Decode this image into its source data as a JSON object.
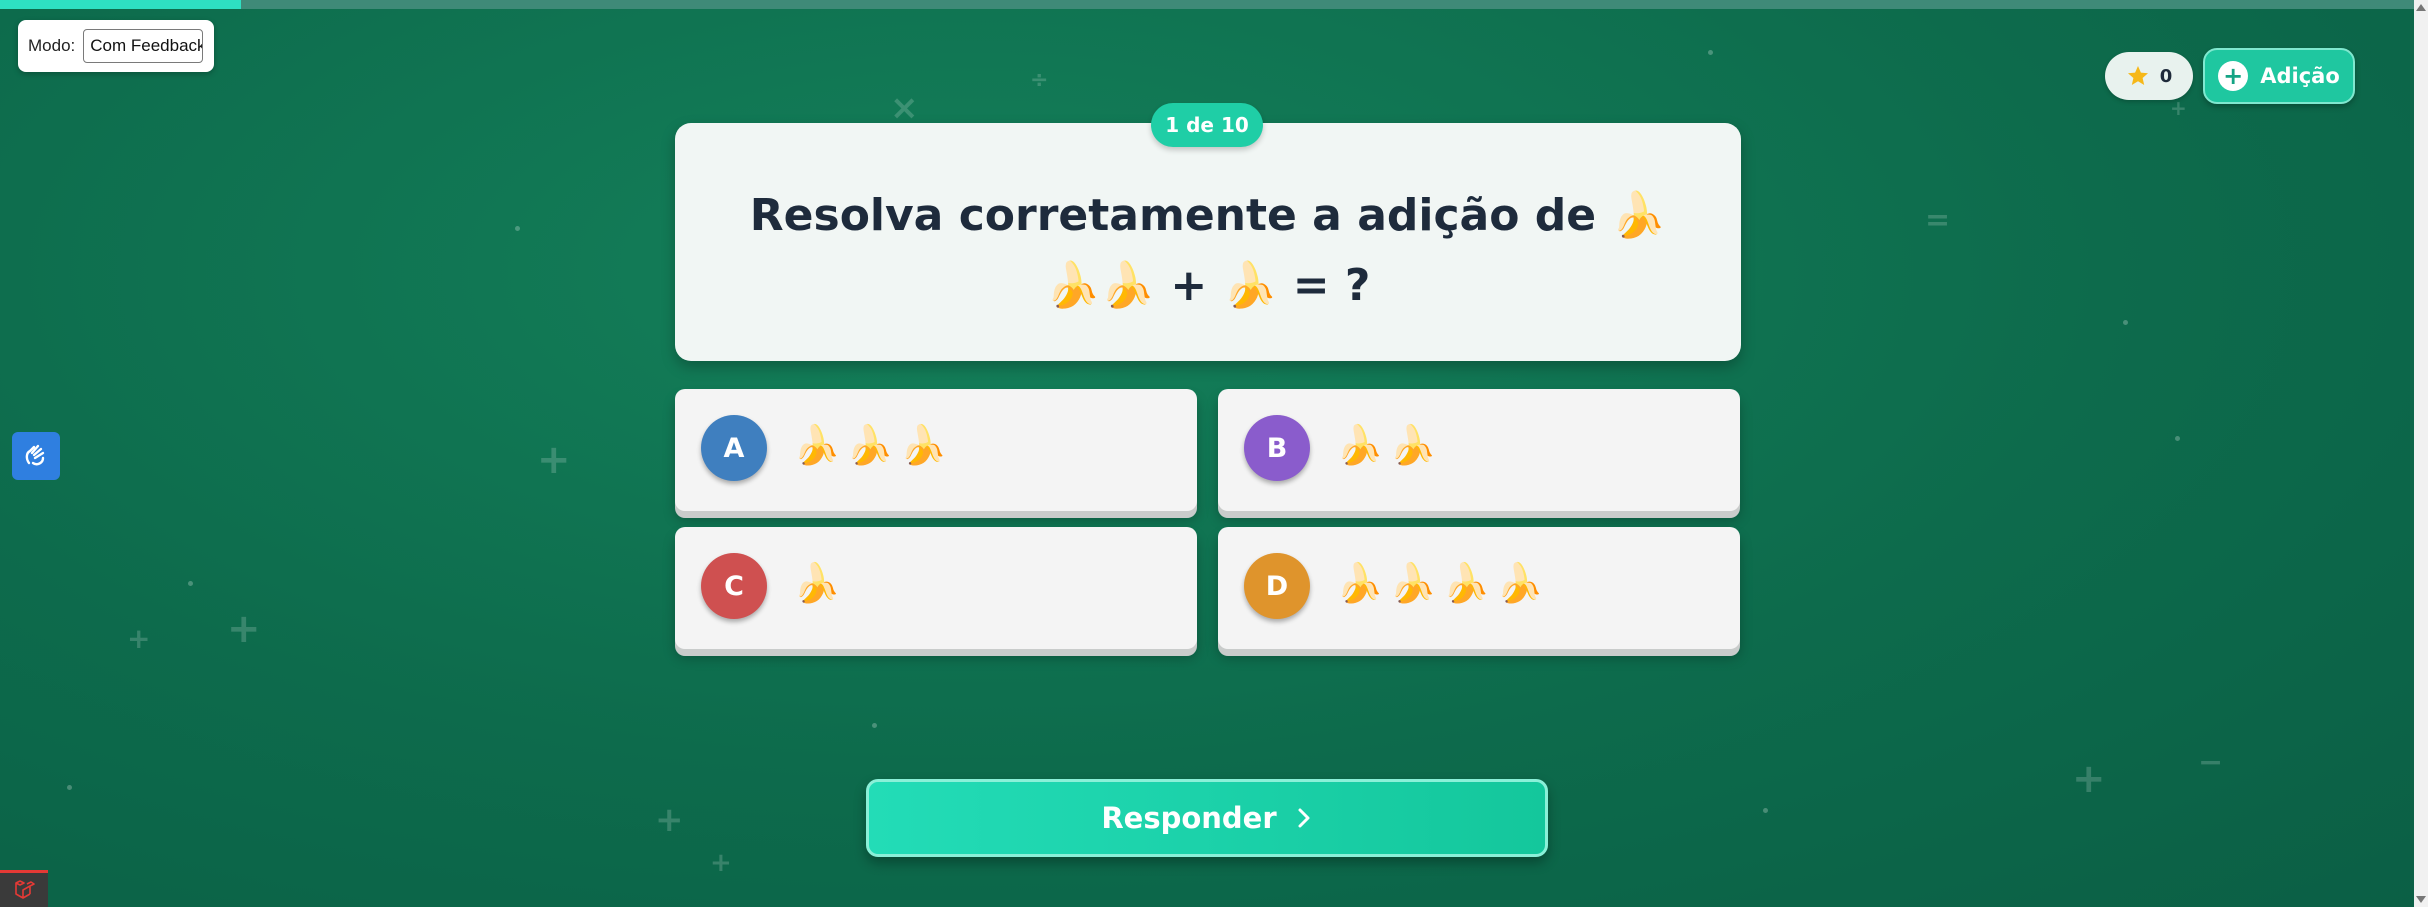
{
  "progress": {
    "fraction": 0.1
  },
  "mode": {
    "label": "Modo:",
    "value": "Com Feedback"
  },
  "score": {
    "icon": "star-icon",
    "value": "0"
  },
  "operation_button": {
    "icon": "plus-icon",
    "label": "Adição"
  },
  "question": {
    "counter": "1 de 10",
    "text": "Resolva corretamente a adição de 🍌🍌🍌 + 🍌 = ?"
  },
  "options": [
    {
      "letter": "A",
      "content": "🍌🍌🍌",
      "color": "#3f7fbf"
    },
    {
      "letter": "B",
      "content": "🍌🍌",
      "color": "#8a5ccc"
    },
    {
      "letter": "C",
      "content": "🍌",
      "color": "#cf5050"
    },
    {
      "letter": "D",
      "content": "🍌🍌🍌🍌",
      "color": "#df942c"
    }
  ],
  "submit": {
    "label": "Responder",
    "icon": "chevron-right-icon"
  },
  "colors": {
    "accent": "#1fcea6",
    "background": "#0d6b4c"
  },
  "side_widgets": {
    "accessibility_icon": "sign-language-hand-icon",
    "debug_icon": "laravel-icon"
  }
}
